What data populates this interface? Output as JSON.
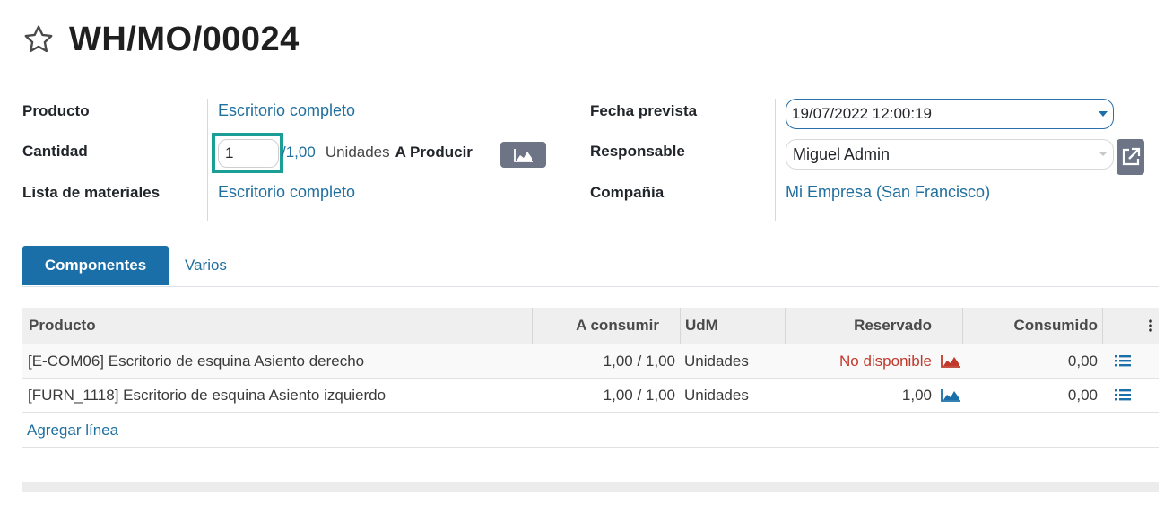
{
  "header": {
    "title": "WH/MO/00024",
    "star_icon": "star-icon"
  },
  "form": {
    "left": {
      "product_label": "Producto",
      "product_value": "Escritorio completo",
      "quantity_label": "Cantidad",
      "quantity_value": "1",
      "quantity_max": "/1,00",
      "quantity_unit": "Unidades",
      "quantity_suffix": "A Producir",
      "bom_label": "Lista de materiales",
      "bom_value": "Escritorio completo"
    },
    "right": {
      "date_label": "Fecha prevista",
      "date_value": "19/07/2022 12:00:19",
      "responsible_label": "Responsable",
      "responsible_value": "Miguel Admin",
      "company_label": "Compañía",
      "company_value": "Mi Empresa (San Francisco)"
    }
  },
  "tabs": [
    {
      "label": "Componentes",
      "active": true
    },
    {
      "label": "Varios",
      "active": false
    }
  ],
  "table": {
    "columns": [
      "Producto",
      "A consumir",
      "UdM",
      "Reservado",
      "Consumido"
    ],
    "rows": [
      {
        "product": "[E-COM06] Escritorio de esquina Asiento derecho",
        "to_consume": "1,00 / 1,00",
        "uom": "Unidades",
        "reserved": "No disponible",
        "reserved_status": "unavailable",
        "consumed": "0,00"
      },
      {
        "product": "[FURN_1118] Escritorio de esquina Asiento izquierdo",
        "to_consume": "1,00 / 1,00",
        "uom": "Unidades",
        "reserved": "1,00",
        "reserved_status": "available",
        "consumed": "0,00"
      }
    ],
    "add_line": "Agregar línea"
  },
  "colors": {
    "link": "#1f6f9f",
    "accent": "#1a6fa8",
    "highlight": "#1a9e96",
    "danger": "#c0392b",
    "button": "#6c7486"
  }
}
